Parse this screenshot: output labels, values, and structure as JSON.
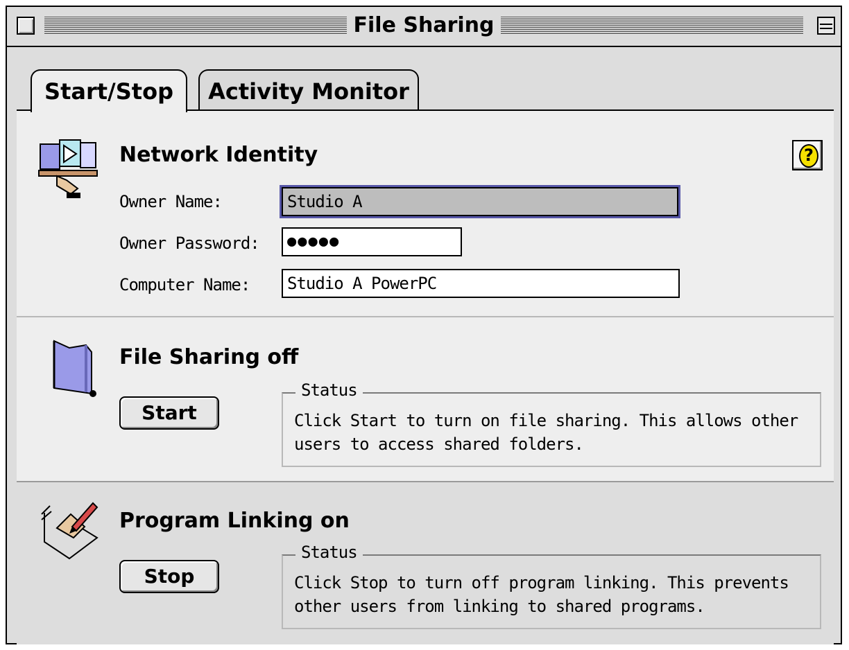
{
  "window": {
    "title": "File Sharing"
  },
  "tabs": [
    {
      "label": "Start/Stop",
      "selected": true
    },
    {
      "label": "Activity Monitor",
      "selected": false
    }
  ],
  "identity": {
    "title": "Network Identity",
    "owner_name_label": "Owner Name:",
    "owner_name_value": "Studio A",
    "owner_password_label": "Owner Password:",
    "owner_password_value": "●●●●●",
    "computer_name_label": "Computer Name:",
    "computer_name_value": "Studio A PowerPC",
    "help_label": "?"
  },
  "file_sharing": {
    "title": "File Sharing off",
    "button_label": "Start",
    "status_label": "Status",
    "status_text": "Click Start to turn on file sharing. This allows other users to access shared folders."
  },
  "program_linking": {
    "title": "Program Linking on",
    "button_label": "Stop",
    "status_label": "Status",
    "status_text": "Click Stop to turn off program linking. This prevents other users from linking to shared programs."
  },
  "colors": {
    "field_focus": "#5757a8",
    "help_icon": "#f5e000",
    "folder": "#9a9ae8"
  },
  "icons": [
    "close-box-icon",
    "collapse-box-icon",
    "network-identity-icon",
    "folder-icon",
    "program-linking-icon",
    "help-icon"
  ]
}
